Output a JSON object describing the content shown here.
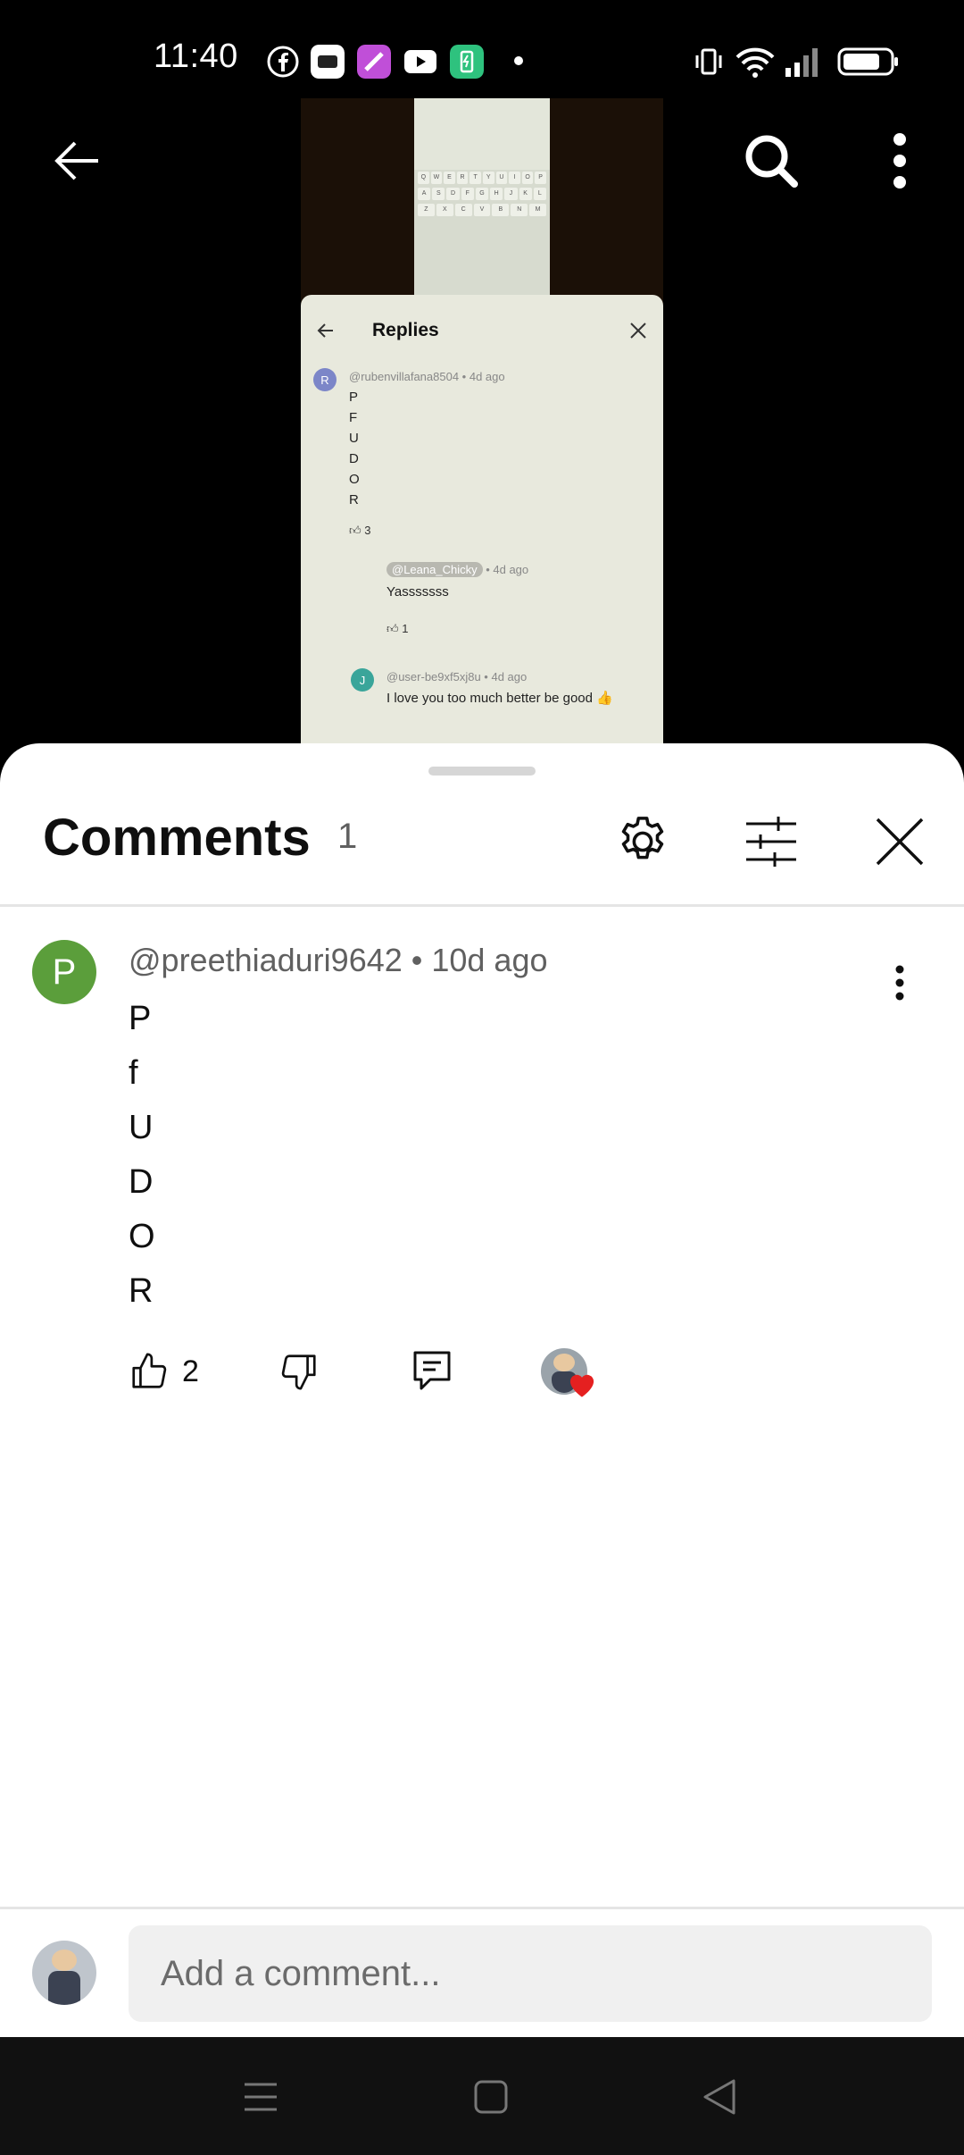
{
  "status_bar": {
    "time": "11:40"
  },
  "video_preview": {
    "panel_title": "Replies",
    "reply1": {
      "avatar_letter": "R",
      "meta": "@rubenvillafana8504 • 4d ago",
      "letters": [
        "P",
        "F",
        "U",
        "D",
        "O",
        "R"
      ],
      "likes": "3"
    },
    "reply2": {
      "handle": "@Leana_Chicky",
      "meta_suffix": "• 4d ago",
      "text": "Yasssssss",
      "likes": "1"
    },
    "reply3": {
      "avatar_letter": "J",
      "meta": "@user-be9xf5xj8u • 4d ago",
      "text": "I love you too much better be good 👍"
    }
  },
  "sheet": {
    "title": "Comments",
    "count": "1"
  },
  "comment": {
    "avatar_letter": "P",
    "meta": "@preethiaduri9642 • 10d ago",
    "letters": [
      "P",
      "f",
      "U",
      "D",
      "O",
      "R"
    ],
    "likes": "2"
  },
  "composer": {
    "placeholder": "Add a comment..."
  },
  "colors": {
    "accent_green": "#5b9e3b",
    "heart_red": "#e52020"
  },
  "icons": [
    "back-arrow-icon",
    "search-icon",
    "more-vert-icon",
    "gear-icon",
    "filter-icon",
    "close-icon",
    "thumb-up-icon",
    "thumb-down-icon",
    "reply-icon",
    "heart-icon",
    "menu-icon",
    "home-square-icon",
    "back-triangle-icon"
  ]
}
